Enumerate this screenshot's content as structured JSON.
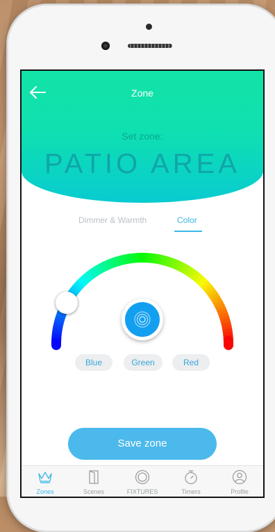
{
  "header": {
    "title": "Zone",
    "set_zone_label": "Set zone:",
    "zone_name": "PATIO AREA"
  },
  "tabs": [
    {
      "label": "Dimmer & Warmth",
      "active": false
    },
    {
      "label": "Color",
      "active": true
    }
  ],
  "color_presets": [
    "Blue",
    "Green",
    "Red"
  ],
  "save_label": "Save zone",
  "tabbar": [
    {
      "label": "Zones",
      "icon": "crown-icon",
      "active": true
    },
    {
      "label": "Scenes",
      "icon": "door-icon",
      "active": false
    },
    {
      "label": "FIXTURES",
      "icon": "fixture-icon",
      "active": false
    },
    {
      "label": "Timers",
      "icon": "stopwatch-icon",
      "active": false
    },
    {
      "label": "Profile",
      "icon": "user-icon",
      "active": false
    }
  ],
  "colors": {
    "header_top": "#13e3a6",
    "header_bottom": "#08cbd0",
    "accent": "#3cb7e6",
    "save_button": "#4cb9ec",
    "selected_color": "#139ff0"
  }
}
